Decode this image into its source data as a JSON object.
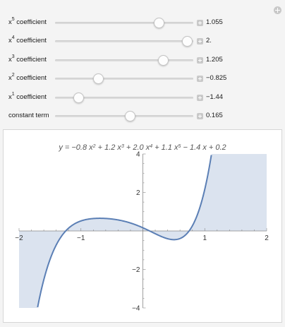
{
  "controls": [
    {
      "base": "x",
      "exp": "5",
      "suffix": " coefficient",
      "value": "1.055",
      "fraction": 0.751
    },
    {
      "base": "x",
      "exp": "4",
      "suffix": " coefficient",
      "value": "2.",
      "fraction": 0.955
    },
    {
      "base": "x",
      "exp": "3",
      "suffix": " coefficient",
      "value": "1.205",
      "fraction": 0.783
    },
    {
      "base": "x",
      "exp": "2",
      "suffix": " coefficient",
      "value": "−0.825",
      "fraction": 0.316
    },
    {
      "base": "x",
      "exp": "1",
      "suffix": " coefficient",
      "value": "−1.44",
      "fraction": 0.172
    },
    {
      "base": "constant term",
      "exp": "",
      "suffix": "",
      "value": "0.165",
      "fraction": 0.542
    }
  ],
  "chart_data": {
    "type": "line",
    "title_parts": [
      "y = −0.8 x",
      "2",
      " + 1.2 x",
      "3",
      " + 2.0 x",
      "4",
      " + 1.1 x",
      "5",
      " − 1.4 x + 0.2"
    ],
    "coefficients": {
      "c0": 0.165,
      "c1": -1.44,
      "c2": -0.825,
      "c3": 1.205,
      "c4": 2.0,
      "c5": 1.055
    },
    "xlim": [
      -2,
      2
    ],
    "ylim": [
      -4,
      4
    ],
    "x_ticks": [
      "−2",
      "−1",
      "1",
      "2"
    ],
    "x_tick_values": [
      -2,
      -1,
      1,
      2
    ],
    "y_ticks": [
      "4",
      "2",
      "−2",
      "−4"
    ],
    "y_tick_values": [
      4,
      2,
      -2,
      -4
    ],
    "line_color": "#5b7fb5",
    "fill_color": "#dbe3ef",
    "filling": "axis"
  }
}
